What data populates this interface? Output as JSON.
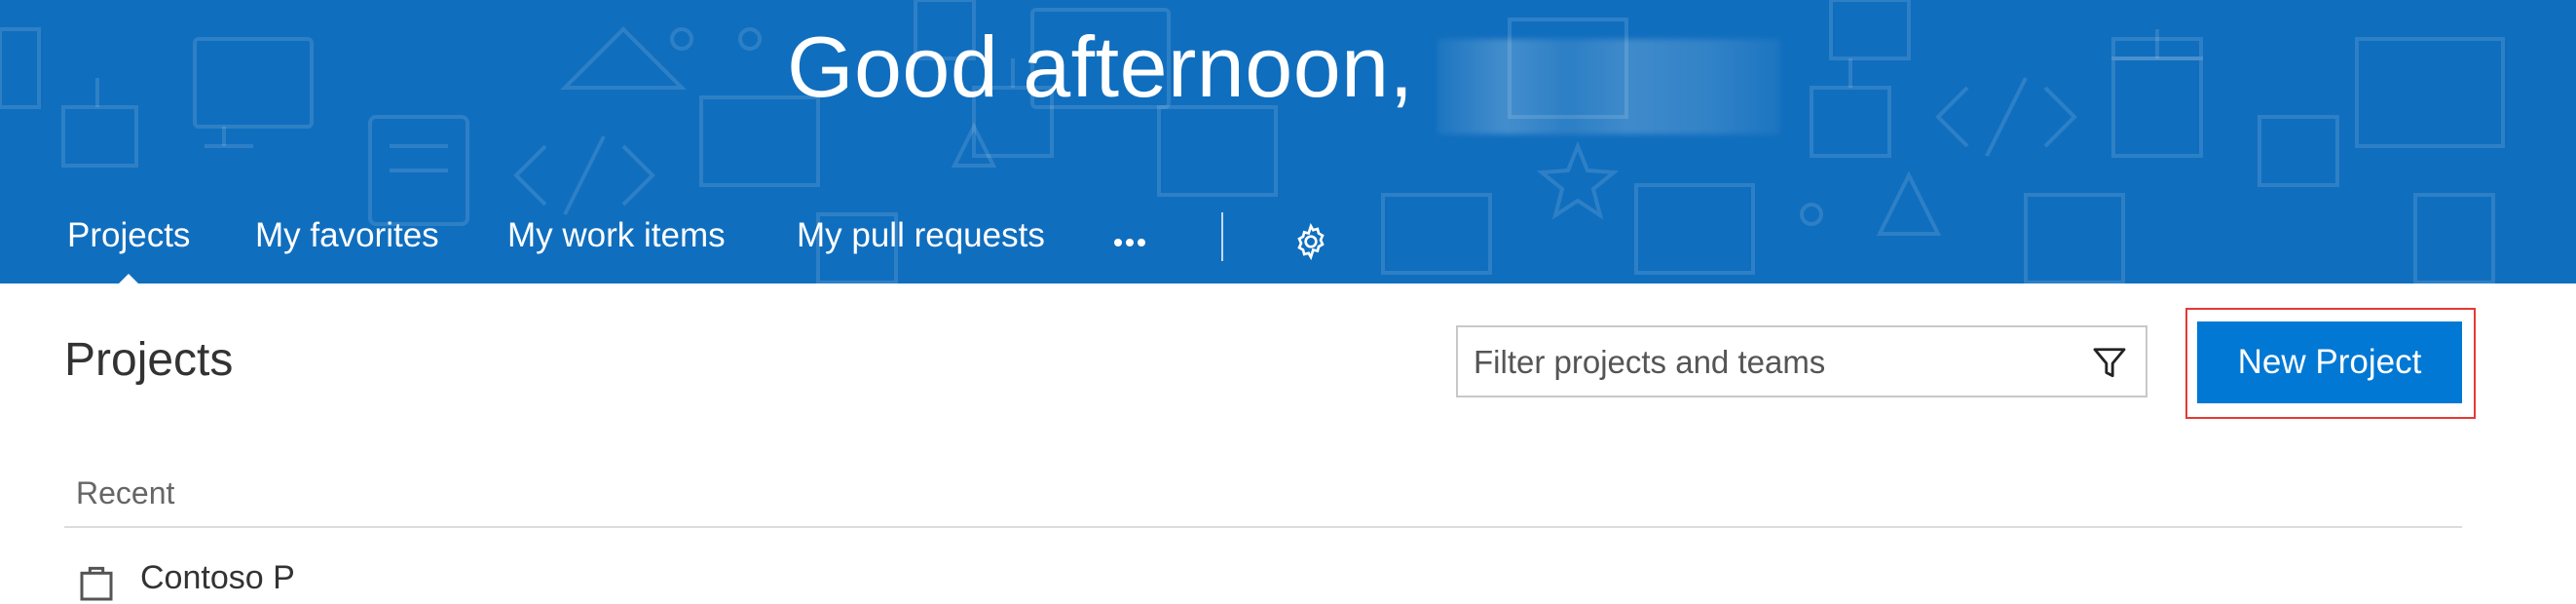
{
  "header": {
    "greeting": "Good afternoon,",
    "background_color": "#106ebe",
    "tabs": [
      {
        "label": "Projects",
        "active": true
      },
      {
        "label": "My favorites",
        "active": false
      },
      {
        "label": "My work items",
        "active": false
      },
      {
        "label": "My pull requests",
        "active": false
      }
    ],
    "more_icon": "ellipsis-icon",
    "settings_icon": "gear-icon"
  },
  "main": {
    "title": "Projects",
    "filter": {
      "placeholder": "Filter projects and teams",
      "value": "",
      "icon": "filter-icon"
    },
    "new_project_label": "New Project",
    "new_project_color": "#0078d4",
    "highlight_color": "#e53935",
    "recent": {
      "label": "Recent",
      "items": [
        {
          "name": "Contoso P",
          "icon": "project-icon"
        }
      ]
    }
  }
}
